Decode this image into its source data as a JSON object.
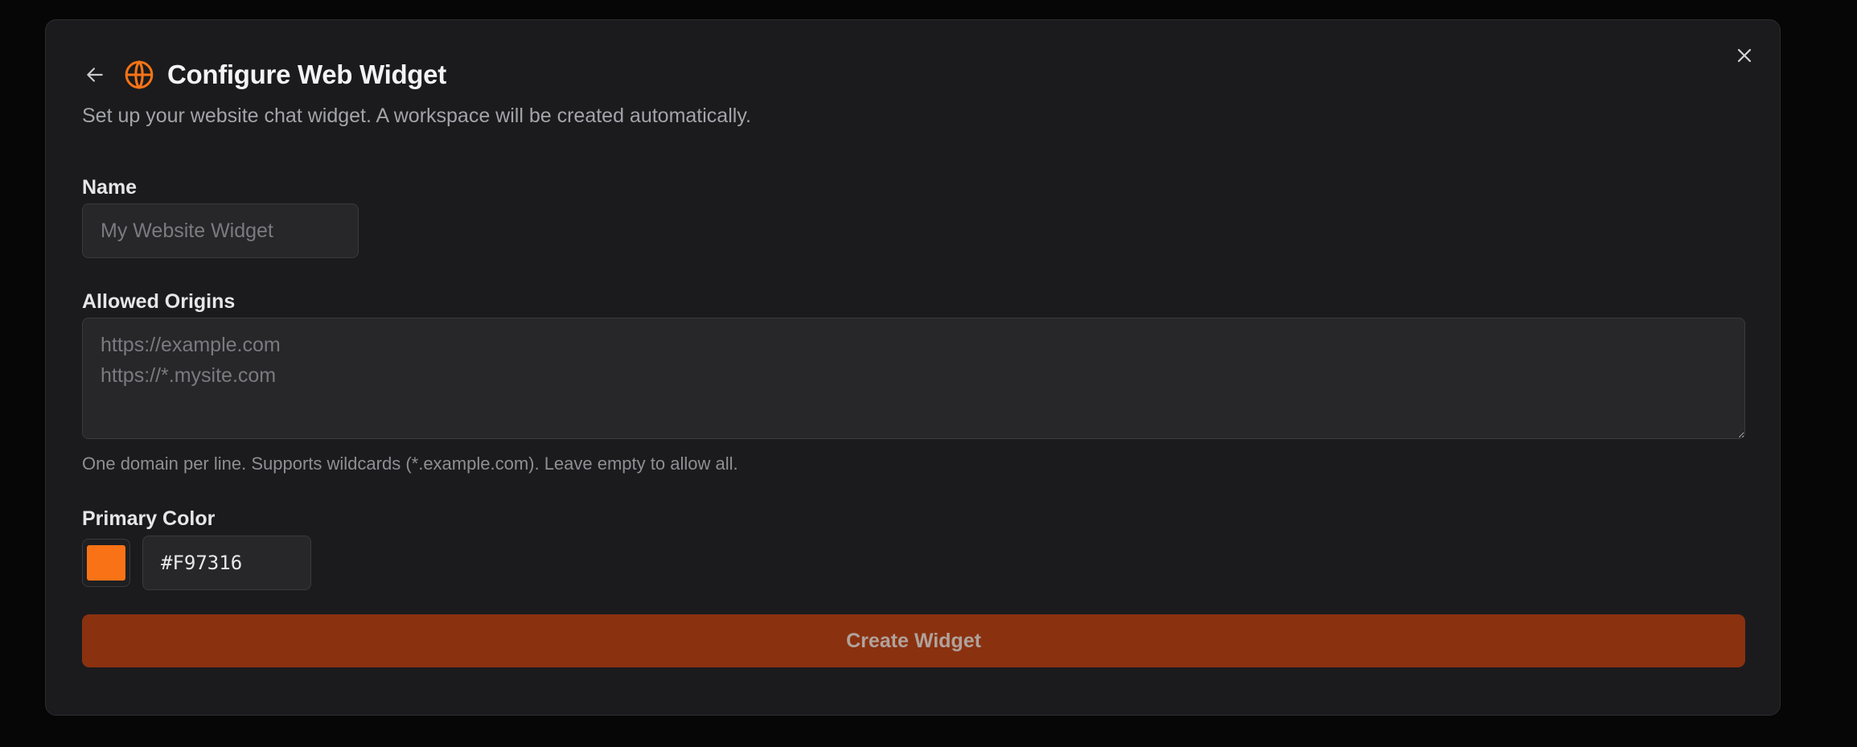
{
  "dialog": {
    "title": "Configure Web Widget",
    "subtitle": "Set up your website chat widget. A workspace will be created automatically.",
    "icons": {
      "back": "arrow-left-icon",
      "title": "globe-icon",
      "close": "close-icon"
    },
    "accent_color": "#F97316"
  },
  "form": {
    "name": {
      "label": "Name",
      "value": "",
      "placeholder": "My Website Widget"
    },
    "origins": {
      "label": "Allowed Origins",
      "value": "",
      "placeholder": "https://example.com\nhttps://*.mysite.com",
      "hint": "One domain per line. Supports wildcards (*.example.com). Leave empty to allow all."
    },
    "primary_color": {
      "label": "Primary Color",
      "value": "#F97316"
    },
    "submit": {
      "label": "Create Widget",
      "disabled": true,
      "color": "#8A3110"
    }
  }
}
